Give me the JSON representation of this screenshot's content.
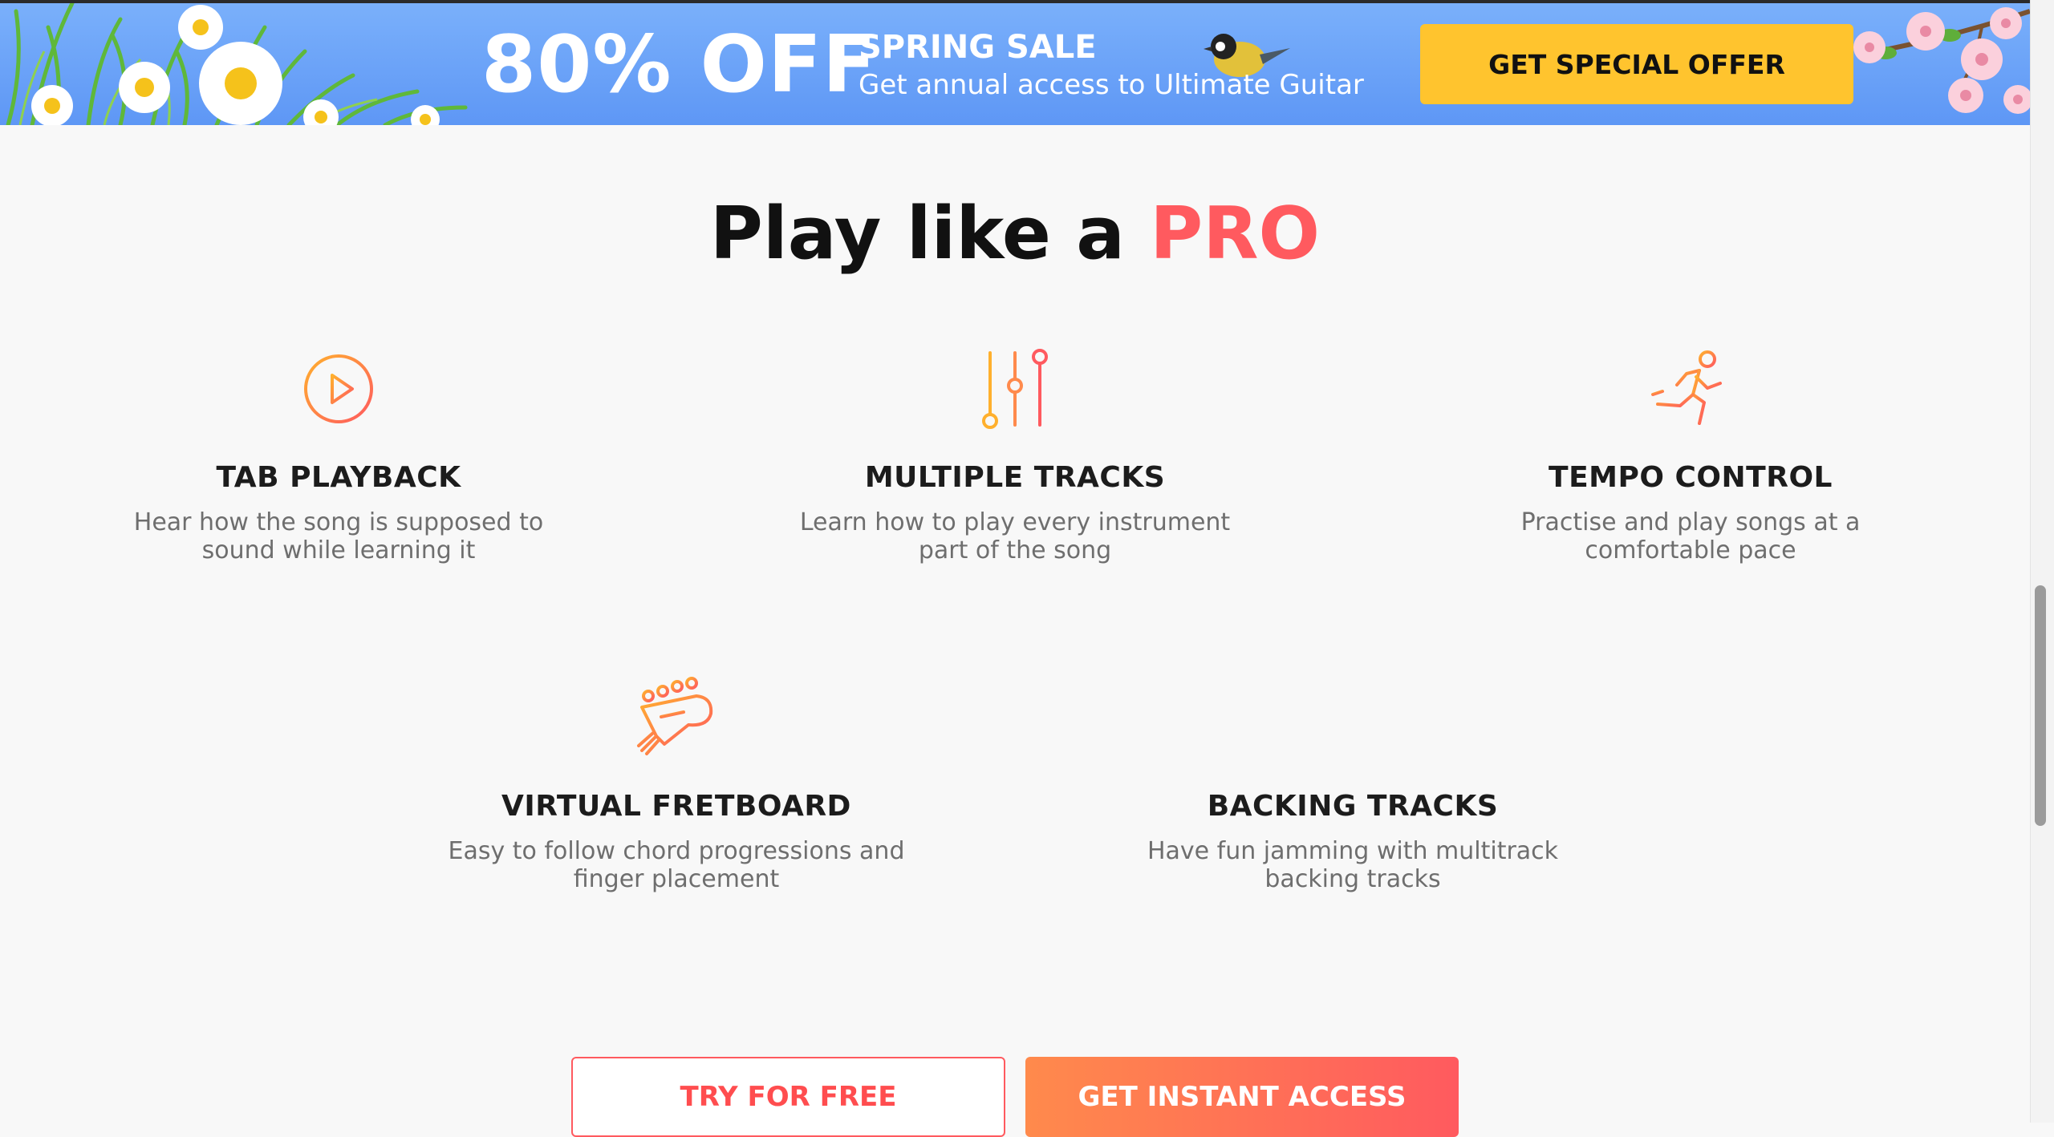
{
  "banner": {
    "headline": "80% OFF",
    "sale_label": "SPRING SALE",
    "subtitle": "Get annual access to Ultimate Guitar",
    "offer_button": "GET SPECIAL OFFER",
    "colors": {
      "background": "#6ea5f8",
      "button": "#ffc42e"
    }
  },
  "section": {
    "title_prefix": "Play like a ",
    "title_accent": "PRO",
    "accent_color": "#ff5a5f"
  },
  "features": [
    {
      "icon": "play-circle-icon",
      "title": "TAB PLAYBACK",
      "description": "Hear how the song is supposed to sound while learning it"
    },
    {
      "icon": "sliders-icon",
      "title": "MULTIPLE TRACKS",
      "description": "Learn how to play every instrument part of the song"
    },
    {
      "icon": "running-man-icon",
      "title": "TEMPO CONTROL",
      "description": "Practise and play songs at a comfortable pace"
    },
    {
      "icon": "guitar-headstock-icon",
      "title": "VIRTUAL FRETBOARD",
      "description": "Easy to follow chord progressions and finger placement"
    },
    {
      "icon": "sound-wave-icon",
      "title": "BACKING TRACKS",
      "description": "Have fun jamming with multitrack backing tracks"
    }
  ],
  "cta": {
    "try_free": "TRY FOR FREE",
    "instant_access": "GET INSTANT ACCESS"
  }
}
